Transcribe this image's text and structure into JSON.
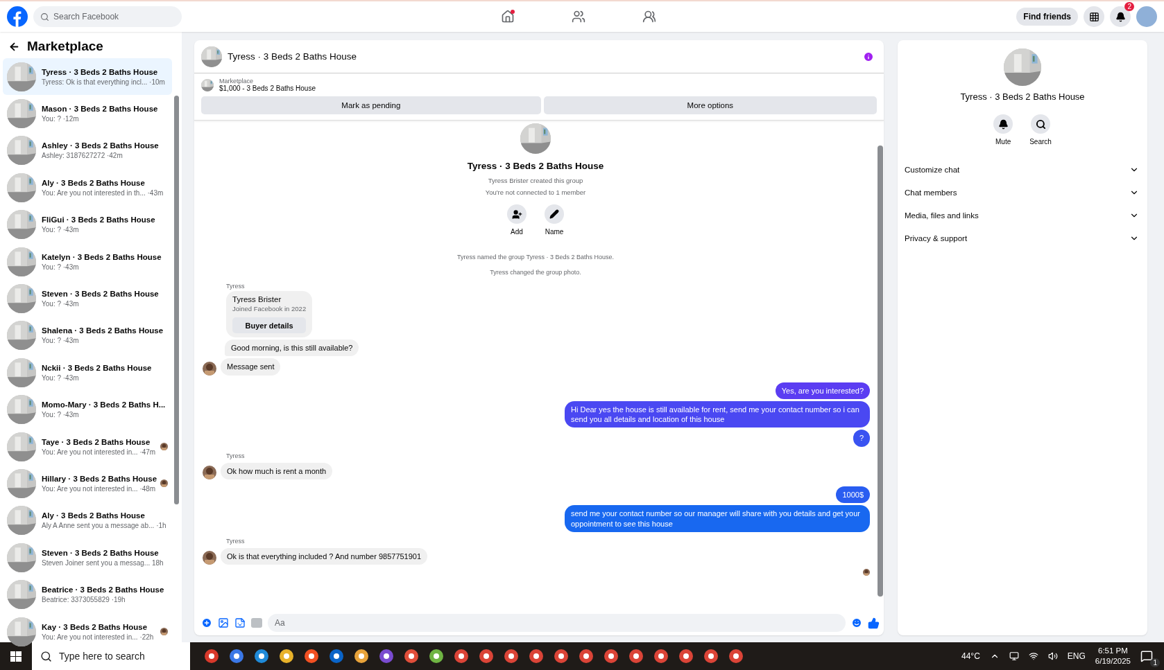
{
  "top_bar": {
    "search": {
      "placeholder": "Search Facebook"
    },
    "nav": [
      {
        "kind": "home",
        "selected": false,
        "dot": true
      },
      {
        "kind": "friends",
        "selected": false,
        "dot": false
      },
      {
        "kind": "groups",
        "selected": false,
        "dot": false
      }
    ],
    "find_friends": "Find friends",
    "notification_count": "2"
  },
  "sidebar": {
    "title": "Marketplace",
    "chats": [
      {
        "name": "Tyress · 3 Beds 2 Baths House",
        "preview": "Tyress: Ok is that everything incl...",
        "time": "·10m",
        "selected": true,
        "seen": false
      },
      {
        "name": "Mason · 3 Beds 2 Baths House",
        "preview": "You: ?",
        "time": "·12m",
        "selected": false,
        "seen": false
      },
      {
        "name": "Ashley · 3 Beds 2 Baths House",
        "preview": "Ashley: 3187627272",
        "time": "·42m",
        "selected": false,
        "seen": false
      },
      {
        "name": "Aly · 3 Beds 2 Baths House",
        "preview": "You: Are you not interested in th...",
        "time": "·43m",
        "selected": false,
        "seen": false
      },
      {
        "name": "FliGui · 3 Beds 2 Baths House",
        "preview": "You: ?",
        "time": "·43m",
        "selected": false,
        "seen": false
      },
      {
        "name": "Katelyn · 3 Beds 2 Baths House",
        "preview": "You: ?",
        "time": "·43m",
        "selected": false,
        "seen": false
      },
      {
        "name": "Steven · 3 Beds 2 Baths House",
        "preview": "You: ?",
        "time": "·43m",
        "selected": false,
        "seen": false
      },
      {
        "name": "Shalena · 3 Beds 2 Baths House",
        "preview": "You: ?",
        "time": "·43m",
        "selected": false,
        "seen": false
      },
      {
        "name": "Nckii · 3 Beds 2 Baths House",
        "preview": "You: ?",
        "time": "·43m",
        "selected": false,
        "seen": false
      },
      {
        "name": "Momo-Mary · 3 Beds 2 Baths H...",
        "preview": "You: ?",
        "time": "·43m",
        "selected": false,
        "seen": false
      },
      {
        "name": "Taye · 3 Beds 2 Baths House",
        "preview": "You: Are you not interested in...",
        "time": "·47m",
        "selected": false,
        "seen": true
      },
      {
        "name": "Hillary · 3 Beds 2 Baths House",
        "preview": "You: Are you not interested in...",
        "time": "·48m",
        "selected": false,
        "seen": true
      },
      {
        "name": "Aly · 3 Beds 2 Baths House",
        "preview": "Aly A Anne sent you a message ab...",
        "time": "·1h",
        "selected": false,
        "seen": false
      },
      {
        "name": "Steven · 3 Beds 2 Baths House",
        "preview": "Steven Joiner sent you a messag...",
        "time": "18h",
        "selected": false,
        "seen": false
      },
      {
        "name": "Beatrice · 3 Beds 2 Baths House",
        "preview": "Beatrice: 3373055829",
        "time": "·19h",
        "selected": false,
        "seen": false
      },
      {
        "name": "Kay · 3 Beds 2 Baths House",
        "preview": "You: Are you not interested in...",
        "time": "·22h",
        "selected": false,
        "seen": true
      }
    ]
  },
  "chat": {
    "title": "Tyress · 3 Beds 2 Baths House",
    "listing": {
      "label": "Marketplace",
      "title": "$1,000 - 3 Beds 2 Baths House"
    },
    "buttons": [
      "Mark as pending",
      "More options"
    ],
    "intro": {
      "title": "Tyress · 3 Beds 2 Baths House",
      "lines": [
        "Tyress Brister created this group",
        "You're not connected to 1 member"
      ],
      "actions": [
        {
          "kind": "add",
          "label": "Add"
        },
        {
          "kind": "name",
          "label": "Name"
        }
      ]
    },
    "notes": [
      "Tyress named the group Tyress · 3 Beds 2 Baths House.",
      "Tyress changed the group photo."
    ],
    "messages": [
      {
        "kind": "sender",
        "text": "Tyress"
      },
      {
        "kind": "card",
        "name": "Tyress Brister",
        "subtitle": "Joined Facebook in 2022",
        "button": "Buyer details"
      },
      {
        "kind": "incoming",
        "text": "Good morning, is this still available?",
        "avatar": false
      },
      {
        "kind": "incoming",
        "text": "Message sent",
        "avatar": true
      },
      {
        "kind": "outgoing",
        "text": "Yes, are you interested?"
      },
      {
        "kind": "outgoing",
        "text": "Hi Dear yes the house is still available for rent, send me your contact number so i can send you all details and location of this house"
      },
      {
        "kind": "outgoing",
        "text": "?"
      },
      {
        "kind": "sender",
        "text": "Tyress"
      },
      {
        "kind": "incoming",
        "text": "Ok how much is rent a month",
        "avatar": true
      },
      {
        "kind": "outgoing",
        "text": "1000$"
      },
      {
        "kind": "outgoing",
        "text": "send me your contact number so our manager will share with you details and get your oppointment to see this house"
      },
      {
        "kind": "sender",
        "text": "Tyress"
      },
      {
        "kind": "incoming",
        "text": "Ok is that everything included ? And number 9857751901",
        "avatar": true
      }
    ],
    "composer": {
      "placeholder": "Aa"
    }
  },
  "details": {
    "title": "Tyress · 3 Beds 2 Baths House",
    "actions": [
      {
        "kind": "mute",
        "label": "Mute"
      },
      {
        "kind": "search",
        "label": "Search"
      }
    ],
    "sections": [
      {
        "label": "Customize chat",
        "expanded": false
      },
      {
        "label": "Chat members",
        "expanded": false
      },
      {
        "label": "Media, files and links",
        "expanded": false
      },
      {
        "label": "Privacy & support",
        "expanded": false
      }
    ]
  },
  "taskbar": {
    "search": {
      "placeholder": "Type here to search"
    },
    "weather": "44°C",
    "language": "ENG",
    "time": "6:51 PM",
    "date": "6/19/2025",
    "notifications": "1"
  }
}
